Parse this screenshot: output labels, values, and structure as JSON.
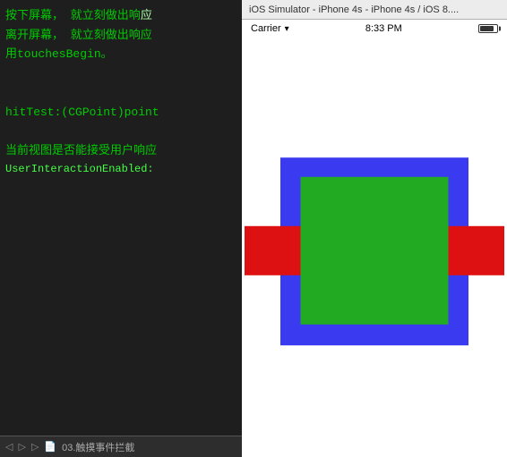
{
  "left_panel": {
    "lines": [
      {
        "text": "按下屏幕，  就立刻做出响应"
      },
      {
        "text": "离开屏幕，  就立刻做出响应"
      },
      {
        "text": "用touchesBegin。"
      },
      {
        "text": ""
      },
      {
        "text": "hitTest:(CGPoint)point"
      },
      {
        "text": ""
      },
      {
        "text": "当前视图是否能接受用户响应"
      },
      {
        "text": "UserInteractionEnabled:"
      }
    ],
    "bottom_bar": {
      "label": "03.触摸事件拦截"
    }
  },
  "simulator": {
    "title": "iOS Simulator - iPhone 4s - iPhone 4s / iOS 8....",
    "status_bar": {
      "carrier": "Carrier",
      "time": "8:33 PM"
    }
  },
  "colors": {
    "blue": "#3a3af0",
    "green": "#22aa22",
    "red": "#dd1111"
  }
}
